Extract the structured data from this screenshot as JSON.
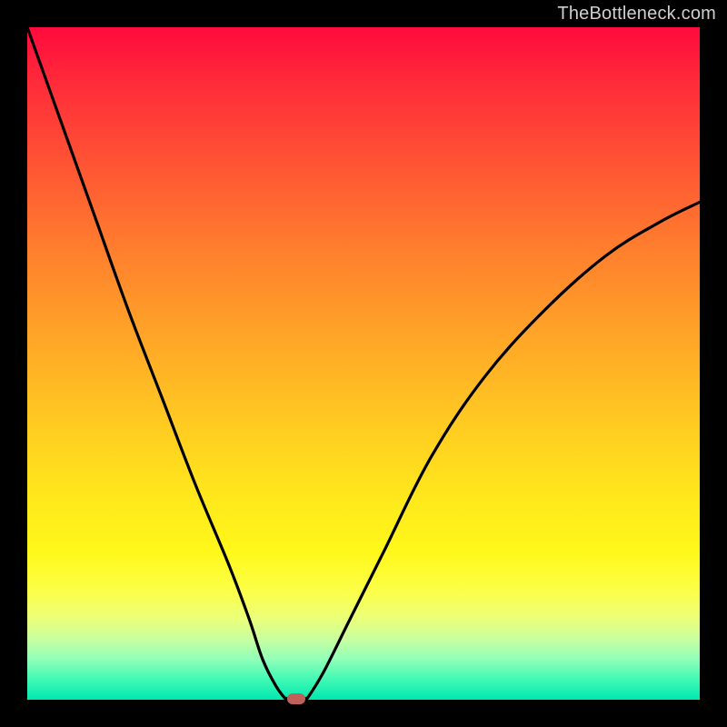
{
  "watermark": "TheBottleneck.com",
  "chart_data": {
    "type": "line",
    "title": "",
    "xlabel": "",
    "ylabel": "",
    "xlim": [
      0,
      100
    ],
    "ylim": [
      0,
      100
    ],
    "grid": false,
    "legend": false,
    "series": [
      {
        "name": "left-branch",
        "x": [
          0,
          5,
          10,
          15,
          20,
          25,
          30,
          33,
          35,
          37,
          38.5
        ],
        "y": [
          100,
          86,
          72,
          58,
          45,
          32,
          20,
          12,
          6,
          2,
          0
        ]
      },
      {
        "name": "right-branch",
        "x": [
          41.5,
          44,
          48,
          53,
          60,
          68,
          77,
          86,
          94,
          100
        ],
        "y": [
          0,
          4,
          12,
          22,
          36,
          48,
          58,
          66,
          71,
          74
        ]
      }
    ],
    "marker": {
      "name": "bottleneck-point",
      "x": 40,
      "y": 0,
      "color": "#c0605a"
    },
    "background_gradient": {
      "top": "#ff0a3c",
      "bottom": "#00e8b0"
    }
  }
}
